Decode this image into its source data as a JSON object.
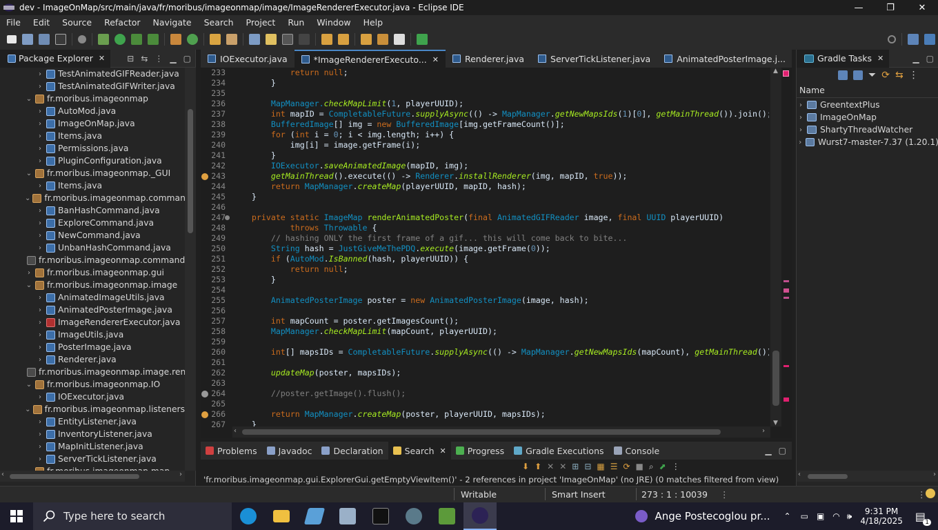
{
  "window": {
    "title": "dev - ImageOnMap/src/main/java/fr/moribus/imageonmap/image/ImageRendererExecutor.java - Eclipse IDE",
    "minimize": "—",
    "maximize": "❐",
    "close": "✕"
  },
  "menu": [
    "File",
    "Edit",
    "Source",
    "Refactor",
    "Navigate",
    "Search",
    "Project",
    "Run",
    "Window",
    "Help"
  ],
  "package_explorer": {
    "title": "Package Explorer",
    "items": [
      {
        "label": "TestAnimatedGIFReader.java",
        "indent": 3,
        "arrow": "›",
        "icon": "java"
      },
      {
        "label": "TestAnimatedGIFWriter.java",
        "indent": 3,
        "arrow": "›",
        "icon": "java"
      },
      {
        "label": "fr.moribus.imageonmap",
        "indent": 2,
        "arrow": "⌄",
        "icon": "pkg"
      },
      {
        "label": "AutoMod.java",
        "indent": 3,
        "arrow": "›",
        "icon": "java"
      },
      {
        "label": "ImageOnMap.java",
        "indent": 3,
        "arrow": "›",
        "icon": "java"
      },
      {
        "label": "Items.java",
        "indent": 3,
        "arrow": "›",
        "icon": "java"
      },
      {
        "label": "Permissions.java",
        "indent": 3,
        "arrow": "›",
        "icon": "java"
      },
      {
        "label": "PluginConfiguration.java",
        "indent": 3,
        "arrow": "›",
        "icon": "java"
      },
      {
        "label": "fr.moribus.imageonmap._GUI",
        "indent": 2,
        "arrow": "⌄",
        "icon": "pkg"
      },
      {
        "label": "Items.java",
        "indent": 3,
        "arrow": "›",
        "icon": "java"
      },
      {
        "label": "fr.moribus.imageonmap.commands",
        "indent": 2,
        "arrow": "⌄",
        "icon": "pkg"
      },
      {
        "label": "BanHashCommand.java",
        "indent": 3,
        "arrow": "›",
        "icon": "java"
      },
      {
        "label": "ExploreCommand.java",
        "indent": 3,
        "arrow": "›",
        "icon": "java"
      },
      {
        "label": "NewCommand.java",
        "indent": 3,
        "arrow": "›",
        "icon": "java"
      },
      {
        "label": "UnbanHashCommand.java",
        "indent": 3,
        "arrow": "›",
        "icon": "java"
      },
      {
        "label": "fr.moribus.imageonmap.commands.",
        "indent": 2,
        "arrow": "",
        "icon": "pkgd"
      },
      {
        "label": "fr.moribus.imageonmap.gui",
        "indent": 2,
        "arrow": "›",
        "icon": "pkg"
      },
      {
        "label": "fr.moribus.imageonmap.image",
        "indent": 2,
        "arrow": "⌄",
        "icon": "pkg"
      },
      {
        "label": "AnimatedImageUtils.java",
        "indent": 3,
        "arrow": "›",
        "icon": "java"
      },
      {
        "label": "AnimatedPosterImage.java",
        "indent": 3,
        "arrow": "›",
        "icon": "java"
      },
      {
        "label": "ImageRendererExecutor.java",
        "indent": 3,
        "arrow": "›",
        "icon": "err"
      },
      {
        "label": "ImageUtils.java",
        "indent": 3,
        "arrow": "›",
        "icon": "java"
      },
      {
        "label": "PosterImage.java",
        "indent": 3,
        "arrow": "›",
        "icon": "java"
      },
      {
        "label": "Renderer.java",
        "indent": 3,
        "arrow": "›",
        "icon": "java"
      },
      {
        "label": "fr.moribus.imageonmap.image.rende",
        "indent": 2,
        "arrow": "",
        "icon": "pkgd"
      },
      {
        "label": "fr.moribus.imageonmap.IO",
        "indent": 2,
        "arrow": "⌄",
        "icon": "pkg"
      },
      {
        "label": "IOExecutor.java",
        "indent": 3,
        "arrow": "›",
        "icon": "java"
      },
      {
        "label": "fr.moribus.imageonmap.listeners",
        "indent": 2,
        "arrow": "⌄",
        "icon": "pkg"
      },
      {
        "label": "EntityListener.java",
        "indent": 3,
        "arrow": "›",
        "icon": "java"
      },
      {
        "label": "InventoryListener.java",
        "indent": 3,
        "arrow": "›",
        "icon": "java"
      },
      {
        "label": "MapInitListener.java",
        "indent": 3,
        "arrow": "›",
        "icon": "java"
      },
      {
        "label": "ServerTickListener.java",
        "indent": 3,
        "arrow": "›",
        "icon": "java"
      },
      {
        "label": "fr.moribus.imageonmap.map",
        "indent": 2,
        "arrow": "⌄",
        "icon": "pkg"
      }
    ]
  },
  "editor": {
    "tabs": [
      {
        "label": "IOExecutor.java",
        "active": false
      },
      {
        "label": "*ImageRendererExecuto...",
        "active": true
      },
      {
        "label": "Renderer.java",
        "active": false
      },
      {
        "label": "ServerTickListener.java",
        "active": false
      },
      {
        "label": "AnimatedPosterImage.j...",
        "active": false
      }
    ],
    "lines": [
      {
        "n": "233",
        "code": [
          [
            "            ",
            ""
          ],
          [
            "return",
            "kw"
          ],
          [
            " ",
            ""
          ],
          [
            "null",
            "kw"
          ],
          [
            ";",
            ""
          ]
        ]
      },
      {
        "n": "234",
        "code": [
          [
            "        }",
            ""
          ]
        ]
      },
      {
        "n": "235",
        "code": [
          [
            "",
            ""
          ]
        ]
      },
      {
        "n": "236",
        "code": [
          [
            "        MapManager.",
            "ty"
          ],
          [
            "checkMapLimit",
            "fn"
          ],
          [
            "(",
            ""
          ],
          [
            "1",
            "nm"
          ],
          [
            ", playerUUID);",
            ""
          ]
        ]
      },
      {
        "n": "237",
        "code": [
          [
            "        ",
            ""
          ],
          [
            "int",
            "kw"
          ],
          [
            " mapID = ",
            ""
          ],
          [
            "CompletableFuture",
            "ty"
          ],
          [
            ".",
            ""
          ],
          [
            "supplyAsync",
            "fn"
          ],
          [
            "(() -> ",
            ""
          ],
          [
            "MapManager",
            "ty"
          ],
          [
            ".",
            ""
          ],
          [
            "getNewMapsIds",
            "fn"
          ],
          [
            "(",
            ""
          ],
          [
            "1",
            "nm"
          ],
          [
            ")[",
            ""
          ],
          [
            "0",
            "nm"
          ],
          [
            "], ",
            ""
          ],
          [
            "getMainThread",
            "fn"
          ],
          [
            "()).join();",
            ""
          ]
        ]
      },
      {
        "n": "238",
        "code": [
          [
            "        ",
            ""
          ],
          [
            "BufferedImage",
            "ty"
          ],
          [
            "[] img = ",
            ""
          ],
          [
            "new",
            "kw"
          ],
          [
            " ",
            ""
          ],
          [
            "BufferedImage",
            "ty"
          ],
          [
            "[img.getFrameCount()];",
            ""
          ]
        ]
      },
      {
        "n": "239",
        "code": [
          [
            "        ",
            ""
          ],
          [
            "for",
            "kw"
          ],
          [
            " (",
            ""
          ],
          [
            "int",
            "kw"
          ],
          [
            " i = ",
            ""
          ],
          [
            "0",
            "nm"
          ],
          [
            "; i < img.length; i++) {",
            ""
          ]
        ]
      },
      {
        "n": "240",
        "code": [
          [
            "            img[i] = image.getFrame(i);",
            ""
          ]
        ]
      },
      {
        "n": "241",
        "code": [
          [
            "        }",
            ""
          ]
        ]
      },
      {
        "n": "242",
        "code": [
          [
            "        ",
            ""
          ],
          [
            "IOExecutor",
            "ty"
          ],
          [
            ".",
            ""
          ],
          [
            "saveAnimatedImage",
            "fn"
          ],
          [
            "(mapID, img);",
            ""
          ]
        ]
      },
      {
        "n": "243",
        "code": [
          [
            "        ",
            ""
          ],
          [
            "getMainThread",
            "fn"
          ],
          [
            "().execute(() -> ",
            ""
          ],
          [
            "Renderer",
            "ty"
          ],
          [
            ".",
            ""
          ],
          [
            "installRenderer",
            "fn"
          ],
          [
            "(img, mapID, ",
            ""
          ],
          [
            "true",
            "kw"
          ],
          [
            "));",
            ""
          ]
        ]
      },
      {
        "n": "244",
        "code": [
          [
            "        ",
            ""
          ],
          [
            "return",
            "kw"
          ],
          [
            " ",
            ""
          ],
          [
            "MapManager",
            "ty"
          ],
          [
            ".",
            ""
          ],
          [
            "createMap",
            "fn"
          ],
          [
            "(playerUUID, mapID, hash);",
            ""
          ]
        ]
      },
      {
        "n": "245",
        "code": [
          [
            "    }",
            ""
          ]
        ]
      },
      {
        "n": "246",
        "code": [
          [
            "",
            ""
          ]
        ]
      },
      {
        "n": "247",
        "code": [
          [
            "    ",
            ""
          ],
          [
            "private",
            "kw"
          ],
          [
            " ",
            ""
          ],
          [
            "static",
            "kw"
          ],
          [
            " ",
            ""
          ],
          [
            "ImageMap",
            "ty"
          ],
          [
            " ",
            ""
          ],
          [
            "renderAnimatedPoster",
            "mt"
          ],
          [
            "(",
            ""
          ],
          [
            "final",
            "kw"
          ],
          [
            " ",
            ""
          ],
          [
            "AnimatedGIFReader",
            "ty"
          ],
          [
            " image, ",
            ""
          ],
          [
            "final",
            "kw"
          ],
          [
            " ",
            ""
          ],
          [
            "UUID",
            "ty"
          ],
          [
            " playerUUID)",
            ""
          ]
        ]
      },
      {
        "n": "248",
        "code": [
          [
            "            ",
            ""
          ],
          [
            "throws",
            "kw"
          ],
          [
            " ",
            ""
          ],
          [
            "Throwable",
            "ty"
          ],
          [
            " {",
            ""
          ]
        ]
      },
      {
        "n": "249",
        "code": [
          [
            "        // hashing ONLY the first frame of a gif... this will come back to bite...",
            "cm"
          ]
        ]
      },
      {
        "n": "250",
        "code": [
          [
            "        ",
            ""
          ],
          [
            "String",
            "ty"
          ],
          [
            " hash = ",
            ""
          ],
          [
            "JustGiveMeThePDQ",
            "ty"
          ],
          [
            ".",
            ""
          ],
          [
            "execute",
            "fn"
          ],
          [
            "(image.getFrame(",
            ""
          ],
          [
            "0",
            "nm"
          ],
          [
            "));",
            ""
          ]
        ]
      },
      {
        "n": "251",
        "code": [
          [
            "        ",
            ""
          ],
          [
            "if",
            "kw"
          ],
          [
            " (",
            ""
          ],
          [
            "AutoMod",
            "ty"
          ],
          [
            ".",
            ""
          ],
          [
            "IsBanned",
            "fn"
          ],
          [
            "(hash, playerUUID)) {",
            ""
          ]
        ]
      },
      {
        "n": "252",
        "code": [
          [
            "            ",
            ""
          ],
          [
            "return",
            "kw"
          ],
          [
            " ",
            ""
          ],
          [
            "null",
            "kw"
          ],
          [
            ";",
            ""
          ]
        ]
      },
      {
        "n": "253",
        "code": [
          [
            "        }",
            ""
          ]
        ]
      },
      {
        "n": "254",
        "code": [
          [
            "",
            ""
          ]
        ]
      },
      {
        "n": "255",
        "code": [
          [
            "        ",
            ""
          ],
          [
            "AnimatedPosterImage",
            "ty"
          ],
          [
            " poster = ",
            ""
          ],
          [
            "new",
            "kw"
          ],
          [
            " ",
            ""
          ],
          [
            "AnimatedPosterImage",
            "ty"
          ],
          [
            "(image, hash);",
            ""
          ]
        ]
      },
      {
        "n": "256",
        "code": [
          [
            "",
            ""
          ]
        ]
      },
      {
        "n": "257",
        "code": [
          [
            "        ",
            ""
          ],
          [
            "int",
            "kw"
          ],
          [
            " mapCount = poster.getImagesCount();",
            ""
          ]
        ]
      },
      {
        "n": "258",
        "code": [
          [
            "        ",
            ""
          ],
          [
            "MapManager",
            "ty"
          ],
          [
            ".",
            ""
          ],
          [
            "checkMapLimit",
            "fn"
          ],
          [
            "(mapCount, playerUUID);",
            ""
          ]
        ]
      },
      {
        "n": "259",
        "code": [
          [
            "",
            ""
          ]
        ]
      },
      {
        "n": "260",
        "code": [
          [
            "        ",
            ""
          ],
          [
            "int",
            "kw"
          ],
          [
            "[] mapsIDs = ",
            ""
          ],
          [
            "CompletableFuture",
            "ty"
          ],
          [
            ".",
            ""
          ],
          [
            "supplyAsync",
            "fn"
          ],
          [
            "(() -> ",
            ""
          ],
          [
            "MapManager",
            "ty"
          ],
          [
            ".",
            ""
          ],
          [
            "getNewMapsIds",
            "fn"
          ],
          [
            "(mapCount), ",
            ""
          ],
          [
            "getMainThread",
            "fn"
          ],
          [
            "());",
            ""
          ]
        ]
      },
      {
        "n": "261",
        "code": [
          [
            "",
            ""
          ]
        ]
      },
      {
        "n": "262",
        "code": [
          [
            "        ",
            ""
          ],
          [
            "updateMap",
            "fn"
          ],
          [
            "(poster, mapsIDs);",
            ""
          ]
        ]
      },
      {
        "n": "263",
        "code": [
          [
            "",
            ""
          ]
        ]
      },
      {
        "n": "264",
        "code": [
          [
            "        //poster.getImage().flush();",
            "cm"
          ]
        ]
      },
      {
        "n": "265",
        "code": [
          [
            "",
            ""
          ]
        ]
      },
      {
        "n": "266",
        "code": [
          [
            "        ",
            ""
          ],
          [
            "return",
            "kw"
          ],
          [
            " ",
            ""
          ],
          [
            "MapManager",
            "ty"
          ],
          [
            ".",
            ""
          ],
          [
            "createMap",
            "fn"
          ],
          [
            "(poster, playerUUID, mapsIDs);",
            ""
          ]
        ]
      },
      {
        "n": "267",
        "code": [
          [
            "    }",
            ""
          ]
        ]
      }
    ]
  },
  "gradle": {
    "title": "Gradle Tasks",
    "column": "Name",
    "projects": [
      "GreentextPlus",
      "ImageOnMap",
      "ShartyThreadWatcher",
      "Wurst7-master-7.37 (1.20.1)"
    ]
  },
  "bottom": {
    "tabs": [
      {
        "label": "Problems",
        "active": false,
        "color": "#d04040"
      },
      {
        "label": "Javadoc",
        "active": false,
        "color": "#8aa0c8"
      },
      {
        "label": "Declaration",
        "active": false,
        "color": "#8aa0c8"
      },
      {
        "label": "Search",
        "active": true,
        "color": "#e8c050"
      },
      {
        "label": "Progress",
        "active": false,
        "color": "#4caf50"
      },
      {
        "label": "Gradle Executions",
        "active": false,
        "color": "#5fa8c8"
      },
      {
        "label": "Console",
        "active": false,
        "color": "#9aa4b8"
      }
    ],
    "search_message": "'fr.moribus.imageonmap.gui.ExplorerGui.getEmptyViewItem()' - 2 references in project 'ImageOnMap' (no JRE) (0 matches filtered from view)"
  },
  "status": {
    "writable": "Writable",
    "insert_mode": "Smart Insert",
    "position": "273 : 1 : 10039"
  },
  "taskbar": {
    "search_placeholder": "Type here to search",
    "notification": "Ange Postecoglou pr...",
    "time": "9:31 PM",
    "date": "4/18/2025",
    "badge": "1"
  }
}
